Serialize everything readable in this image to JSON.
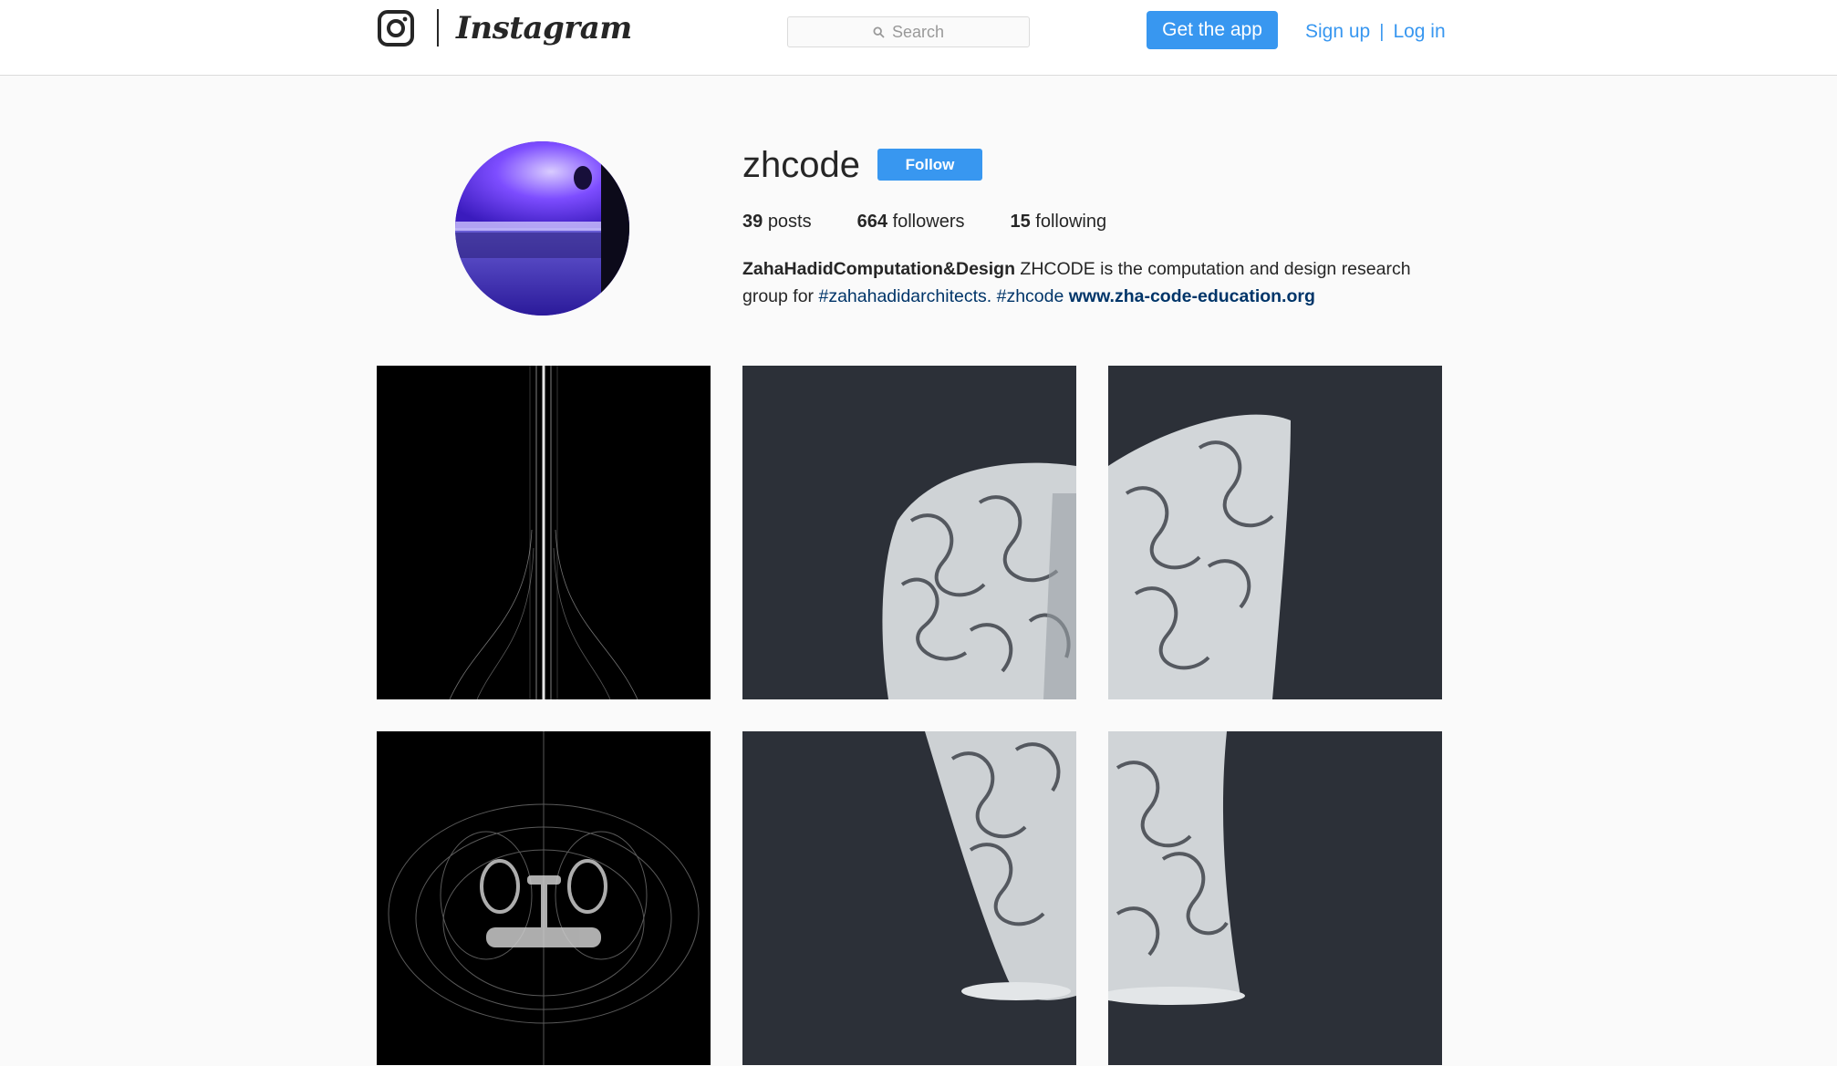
{
  "header": {
    "wordmark": "Instagram",
    "search_placeholder": "Search",
    "get_app_label": "Get the app",
    "sign_up_label": "Sign up",
    "separator": "|",
    "log_in_label": "Log in"
  },
  "profile": {
    "username": "zhcode",
    "follow_label": "Follow",
    "stats": {
      "posts_count": "39",
      "posts_label": "posts",
      "followers_count": "664",
      "followers_label": "followers",
      "following_count": "15",
      "following_label": "following"
    },
    "bio": {
      "full_name": "ZahaHadidComputation&Design",
      "text1": " ZHCODE is the computation and design research group for ",
      "tag1": "#zahahadidarchitects.",
      "space": " ",
      "tag2": "#zhcode",
      "link": "www.zha-code-education.org"
    }
  },
  "colors": {
    "accent": "#3897f0",
    "link_dark": "#003569",
    "background": "#fafafa",
    "border": "#dbdbdb"
  },
  "icons": {
    "logo": "instagram-camera-icon",
    "search": "search-icon"
  },
  "posts": [
    {
      "subject": "black-field-light-lines"
    },
    {
      "subject": "white-lattice-sculpture"
    },
    {
      "subject": "white-lattice-sculpture"
    },
    {
      "subject": "black-field-wireframe-chair"
    },
    {
      "subject": "white-lattice-sculpture"
    },
    {
      "subject": "white-lattice-sculpture"
    }
  ]
}
